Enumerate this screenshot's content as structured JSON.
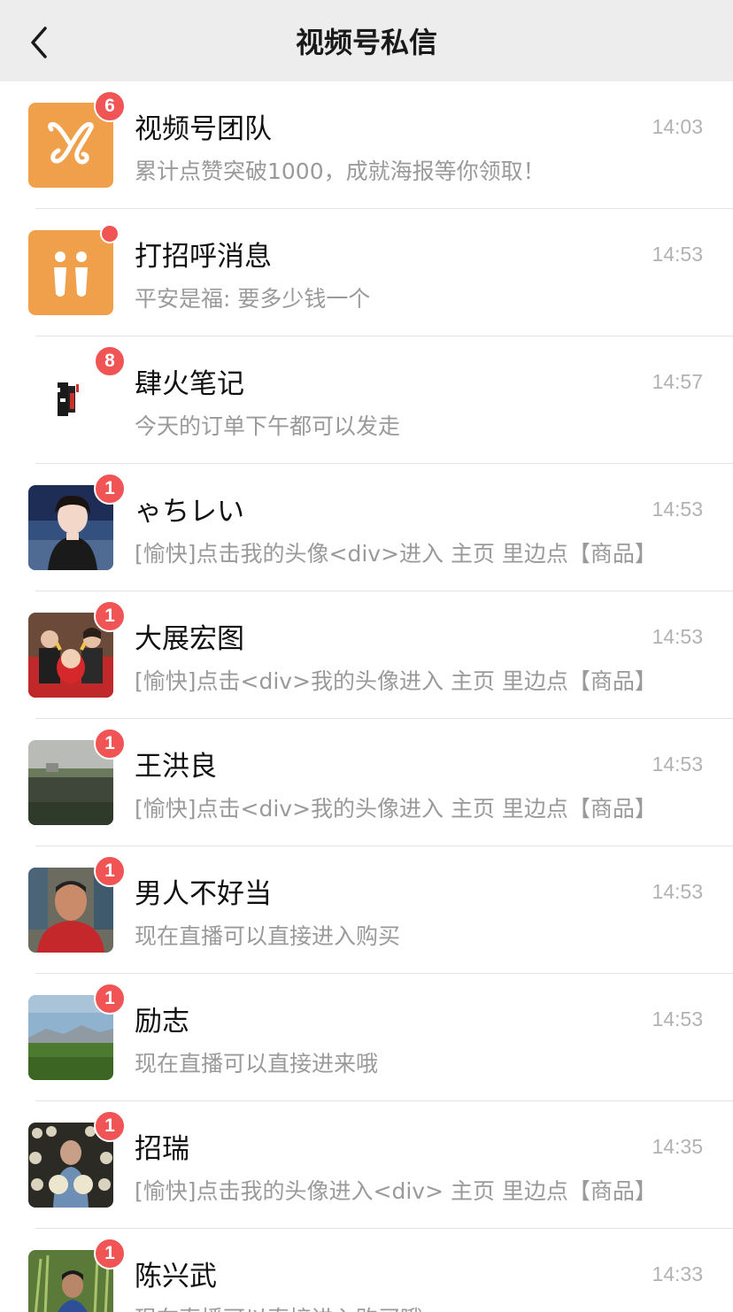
{
  "header": {
    "title": "视频号私信"
  },
  "conversations": [
    {
      "name": "视频号团队",
      "message": "累计点赞突破1000，成就海报等你领取！",
      "time": "14:03",
      "badge": "6",
      "avatar": "butterfly-logo"
    },
    {
      "name": "打招呼消息",
      "message": "平安是福: 要多少钱一个",
      "time": "14:53",
      "badge": "",
      "avatar": "greeting-icon"
    },
    {
      "name": "肆火笔记",
      "message": "今天的订单下午都可以发走",
      "time": "14:57",
      "badge": "8",
      "avatar": "brand-logo"
    },
    {
      "name": "ゃちレい",
      "message": "[愉快]点击我的头像<div>进入 主页 里边点【商品】",
      "time": "14:53",
      "badge": "1",
      "avatar": "photo"
    },
    {
      "name": "大展宏图",
      "message": "[愉快]点击<div>我的头像进入 主页 里边点【商品】",
      "time": "14:53",
      "badge": "1",
      "avatar": "photo"
    },
    {
      "name": "王洪良",
      "message": "[愉快]点击<div>我的头像进入 主页 里边点【商品】",
      "time": "14:53",
      "badge": "1",
      "avatar": "photo"
    },
    {
      "name": "男人不好当",
      "message": "现在直播可以直接进入购买",
      "time": "14:53",
      "badge": "1",
      "avatar": "photo"
    },
    {
      "name": "励志",
      "message": "现在直播可以直接进来哦",
      "time": "14:53",
      "badge": "1",
      "avatar": "photo"
    },
    {
      "name": "招瑞",
      "message": "[愉快]点击我的头像进入<div> 主页 里边点【商品】",
      "time": "14:35",
      "badge": "1",
      "avatar": "photo"
    },
    {
      "name": "陈兴武",
      "message": "现在直播可以直接进入购买哦",
      "time": "14:33",
      "badge": "1",
      "avatar": "photo"
    }
  ],
  "colors": {
    "accent_orange": "#f0a04b",
    "badge_red": "#f05454"
  }
}
